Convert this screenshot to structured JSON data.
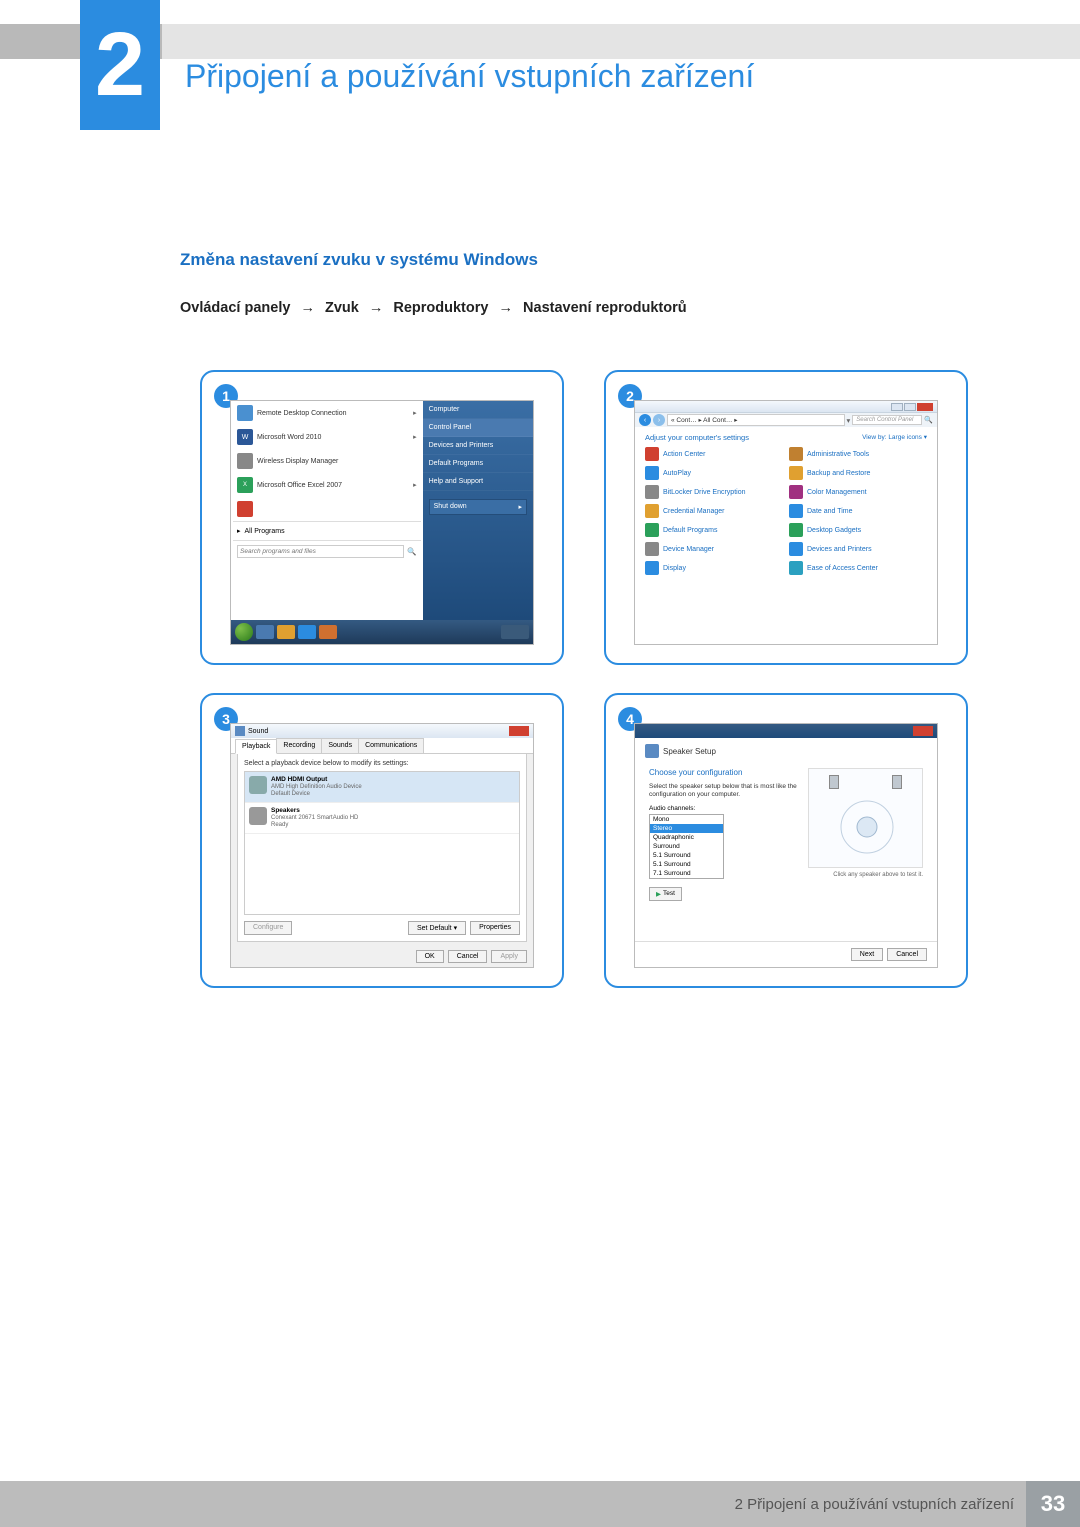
{
  "chapter": {
    "number": "2",
    "title": "Připojení a používání vstupních zařízení"
  },
  "section_title": "Změna nastavení zvuku v systému Windows",
  "breadcrumb": {
    "p1": "Ovládací panely",
    "p2": "Zvuk",
    "p3": "Reproduktory",
    "p4": "Nastavení reproduktorů",
    "arrow": "→"
  },
  "panels": {
    "n1": "1",
    "n2": "2",
    "n3": "3",
    "n4": "4"
  },
  "start_menu": {
    "items": [
      {
        "label": "Remote Desktop Connection"
      },
      {
        "label": "Microsoft Word 2010"
      },
      {
        "label": "Wireless Display Manager"
      },
      {
        "label": "Microsoft Office Excel 2007"
      },
      {
        "label": ""
      }
    ],
    "all_programs": "All Programs",
    "search_placeholder": "Search programs and files",
    "right": [
      "Computer",
      "Control Panel",
      "Devices and Printers",
      "Default Programs",
      "Help and Support"
    ],
    "shutdown": "Shut down"
  },
  "control_panel": {
    "path": "« Cont… ▸ All Cont… ▸",
    "search_placeholder": "Search Control Panel",
    "adjust": "Adjust your computer's settings",
    "view_by": "View by:  Large icons ▾",
    "items_left": [
      "Action Center",
      "AutoPlay",
      "BitLocker Drive Encryption",
      "Credential Manager",
      "Default Programs",
      "Device Manager",
      "Display"
    ],
    "items_right": [
      "Administrative Tools",
      "Backup and Restore",
      "Color Management",
      "Date and Time",
      "Desktop Gadgets",
      "Devices and Printers",
      "Ease of Access Center"
    ],
    "icon_colors_left": [
      "#d04030",
      "#2b8ce0",
      "#888",
      "#e0a030",
      "#2ba05a",
      "#888",
      "#2b8ce0"
    ],
    "icon_colors_right": [
      "#c08030",
      "#e0a030",
      "#a03080",
      "#2b8ce0",
      "#2ba05a",
      "#2b8ce0",
      "#2ba0c0"
    ]
  },
  "sound_dialog": {
    "title": "Sound",
    "tabs": [
      "Playback",
      "Recording",
      "Sounds",
      "Communications"
    ],
    "active_tab": 0,
    "desc": "Select a playback device below to modify its settings:",
    "devices": [
      {
        "title": "AMD HDMI Output",
        "sub1": "AMD High Definition Audio Device",
        "sub2": "Default Device",
        "selected": true
      },
      {
        "title": "Speakers",
        "sub1": "Conexant 20671 SmartAudio HD",
        "sub2": "Ready",
        "selected": false
      }
    ],
    "configure": "Configure",
    "set_default": "Set Default ▾",
    "properties": "Properties",
    "ok": "OK",
    "cancel": "Cancel",
    "apply": "Apply"
  },
  "speaker_setup": {
    "header": "Speaker Setup",
    "choose": "Choose your configuration",
    "desc": "Select the speaker setup below that is most like the configuration on your computer.",
    "label": "Audio channels:",
    "options": [
      "Mono",
      "Stereo",
      "Quadraphonic",
      "Surround",
      "5.1 Surround",
      "5.1 Surround",
      "7.1 Surround"
    ],
    "selected": 1,
    "test": "Test",
    "click_hint": "Click any speaker above to test it.",
    "next": "Next",
    "cancel": "Cancel"
  },
  "footer": {
    "text": "2 Připojení a používání vstupních zařízení",
    "page": "33"
  }
}
